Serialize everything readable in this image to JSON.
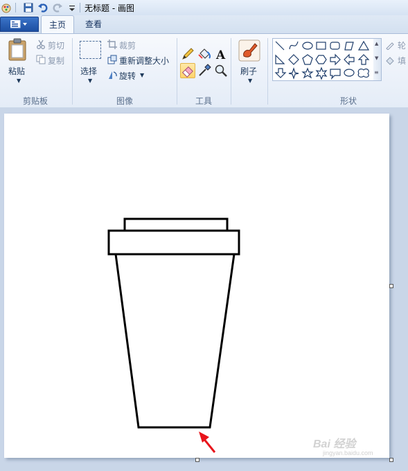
{
  "window": {
    "title": "无标题 - 画图"
  },
  "tabs": [
    {
      "label": "主页",
      "active": true
    },
    {
      "label": "查看",
      "active": false
    }
  ],
  "ribbon": {
    "clipboard": {
      "paste": "粘贴",
      "cut": "剪切",
      "copy": "复制",
      "group": "剪贴板"
    },
    "image": {
      "select": "选择",
      "crop": "裁剪",
      "resize": "重新调整大小",
      "rotate": "旋转",
      "group": "图像"
    },
    "tools": {
      "group": "工具",
      "active_tool": "eraser-icon"
    },
    "brush": {
      "label": "刷子"
    },
    "shapes": {
      "group": "形状",
      "outline": "轮",
      "fill": "填"
    }
  },
  "watermark": {
    "text": "Bai 经验",
    "sub": "jingyan.baidu.com"
  },
  "colors": {
    "accent": "#1d4fa2",
    "annotation_arrow": "#e8141b",
    "canvas": "#ffffff"
  }
}
